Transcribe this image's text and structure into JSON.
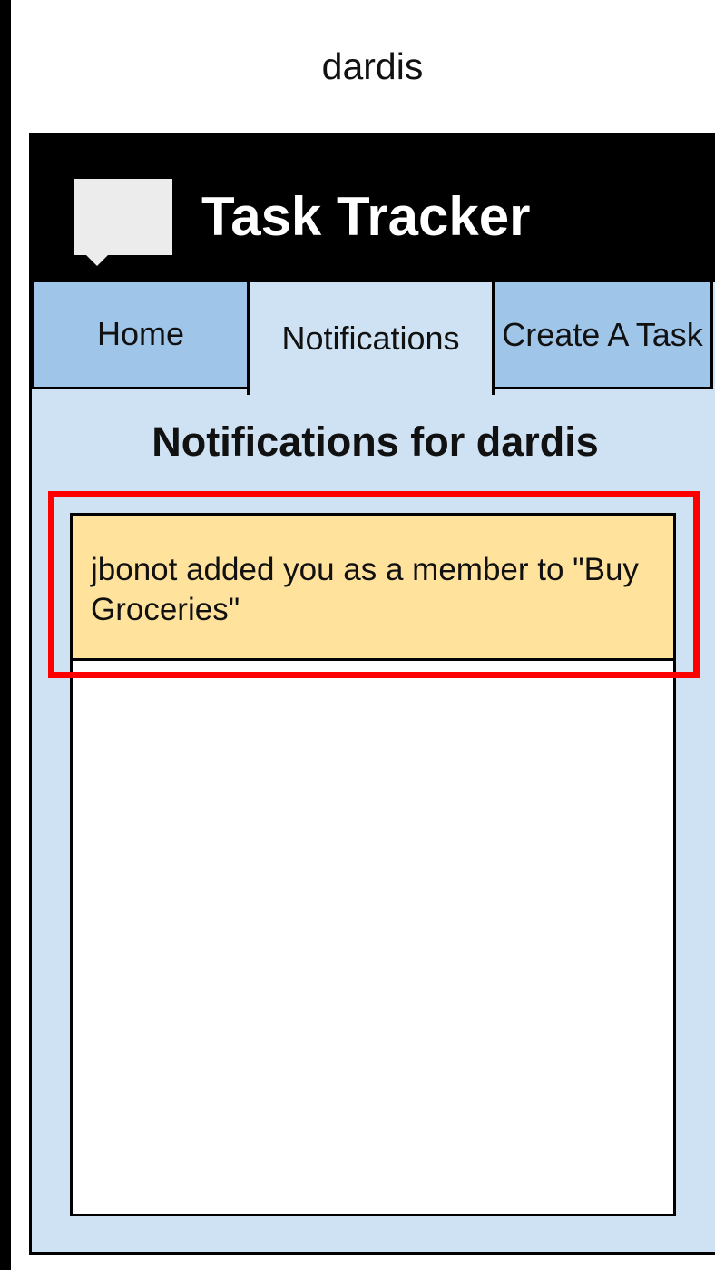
{
  "user_label": "dardis",
  "app": {
    "title": "Task Tracker",
    "logo_icon": "speech-bubble-logo-icon"
  },
  "tabs": [
    {
      "label": "Home",
      "active": false
    },
    {
      "label": "Notifications",
      "active": true
    },
    {
      "label": "Create A Task",
      "active": false
    }
  ],
  "notifications": {
    "heading": "Notifications for dardis",
    "items": [
      {
        "text": "jbonot added you as a member to \"Buy Groceries\"",
        "highlighted": true
      }
    ]
  },
  "colors": {
    "header_bg": "#000000",
    "tab_inactive": "#9fc5e8",
    "page_bg": "#cfe2f3",
    "notification_bg": "#ffe29c",
    "highlight": "#ff0000"
  }
}
